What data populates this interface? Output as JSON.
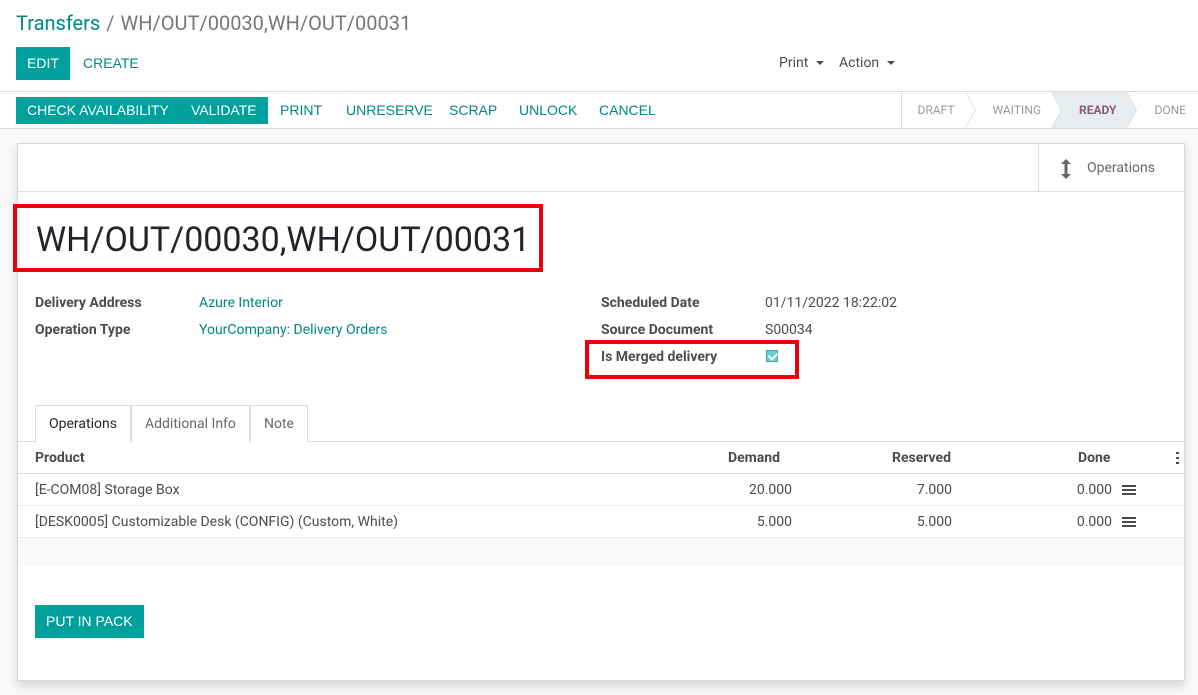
{
  "breadcrumb": {
    "parent": "Transfers",
    "separator": "/",
    "current": "WH/OUT/00030,WH/OUT/00031"
  },
  "control": {
    "edit": "EDIT",
    "create": "CREATE",
    "print": "Print",
    "action": "Action"
  },
  "statusbar": {
    "buttons": [
      "CHECK AVAILABILITY",
      "VALIDATE",
      "PRINT",
      "UNRESERVE",
      "SCRAP",
      "UNLOCK",
      "CANCEL"
    ],
    "stages": [
      "DRAFT",
      "WAITING",
      "READY",
      "DONE"
    ],
    "active_stage": "READY"
  },
  "smart_button": {
    "label": "Operations",
    "icon": "arrows-v-icon"
  },
  "record": {
    "title": "WH/OUT/00030,WH/OUT/00031",
    "delivery_address_label": "Delivery Address",
    "delivery_address": "Azure Interior",
    "operation_type_label": "Operation Type",
    "operation_type": "YourCompany: Delivery Orders",
    "scheduled_date_label": "Scheduled Date",
    "scheduled_date": "01/11/2022 18:22:02",
    "source_document_label": "Source Document",
    "source_document": "S00034",
    "is_merged_label": "Is Merged delivery",
    "is_merged": true
  },
  "tabs": [
    "Operations",
    "Additional Info",
    "Note"
  ],
  "table": {
    "columns": [
      "Product",
      "Demand",
      "Reserved",
      "Done"
    ],
    "rows": [
      {
        "product": "[E-COM08] Storage Box",
        "demand": "20.000",
        "reserved": "7.000",
        "done": "0.000"
      },
      {
        "product": "[DESK0005] Customizable Desk (CONFIG) (Custom, White)",
        "demand": "5.000",
        "reserved": "5.000",
        "done": "0.000"
      }
    ]
  },
  "put_in_pack": "PUT IN PACK",
  "colors": {
    "primary": "#00A09D",
    "link": "#008784",
    "highlight": "#e8000b",
    "active_stage": "#875a7b"
  }
}
